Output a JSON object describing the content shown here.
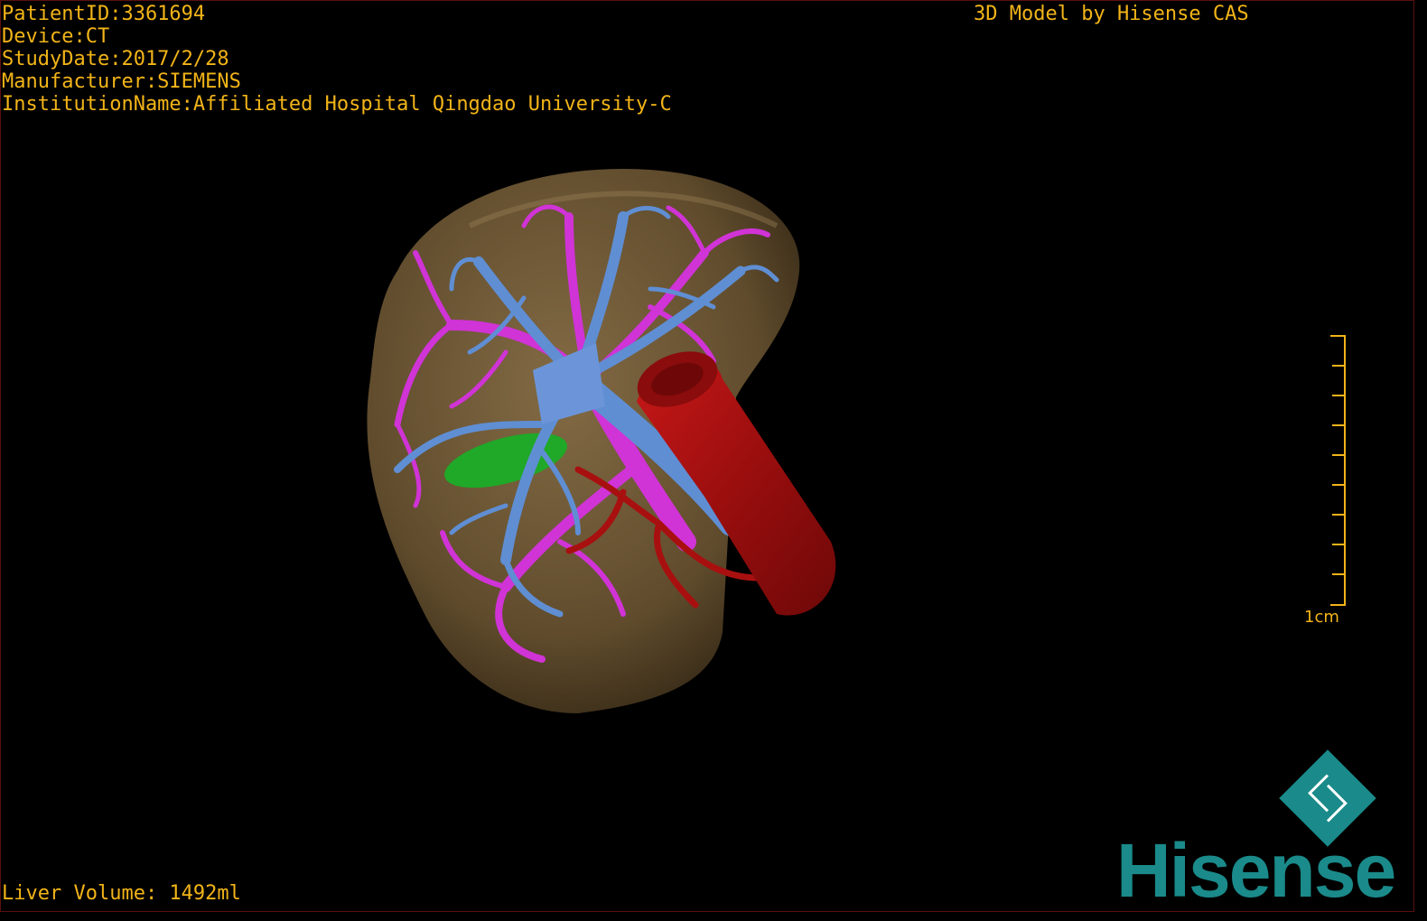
{
  "patient_info": {
    "patient_id": "PatientID:3361694",
    "device": "Device:CT",
    "study_date": "StudyDate:2017/2/28",
    "manufacturer": "Manufacturer:SIEMENS",
    "institution": "InstitutionName:Affiliated Hospital Qingdao University-C"
  },
  "credit": "3D Model by Hisense CAS",
  "liver_volume": "Liver Volume: 1492ml",
  "scale_bar": {
    "label": "1cm",
    "ticks": 10
  },
  "brand": {
    "name": "Hisense",
    "logo_icon": "hisense-diamond-logo-icon"
  },
  "colors": {
    "overlay_text": "#f2b418",
    "liver": "#6b5535",
    "portal_vein": "#d033d6",
    "hepatic_vein": "#5f8ed3",
    "artery_ivc": "#b01212",
    "gallbladder": "#20b030",
    "brand": "#1a8a8a"
  },
  "model": {
    "icon": "liver-3d-model-icon"
  }
}
